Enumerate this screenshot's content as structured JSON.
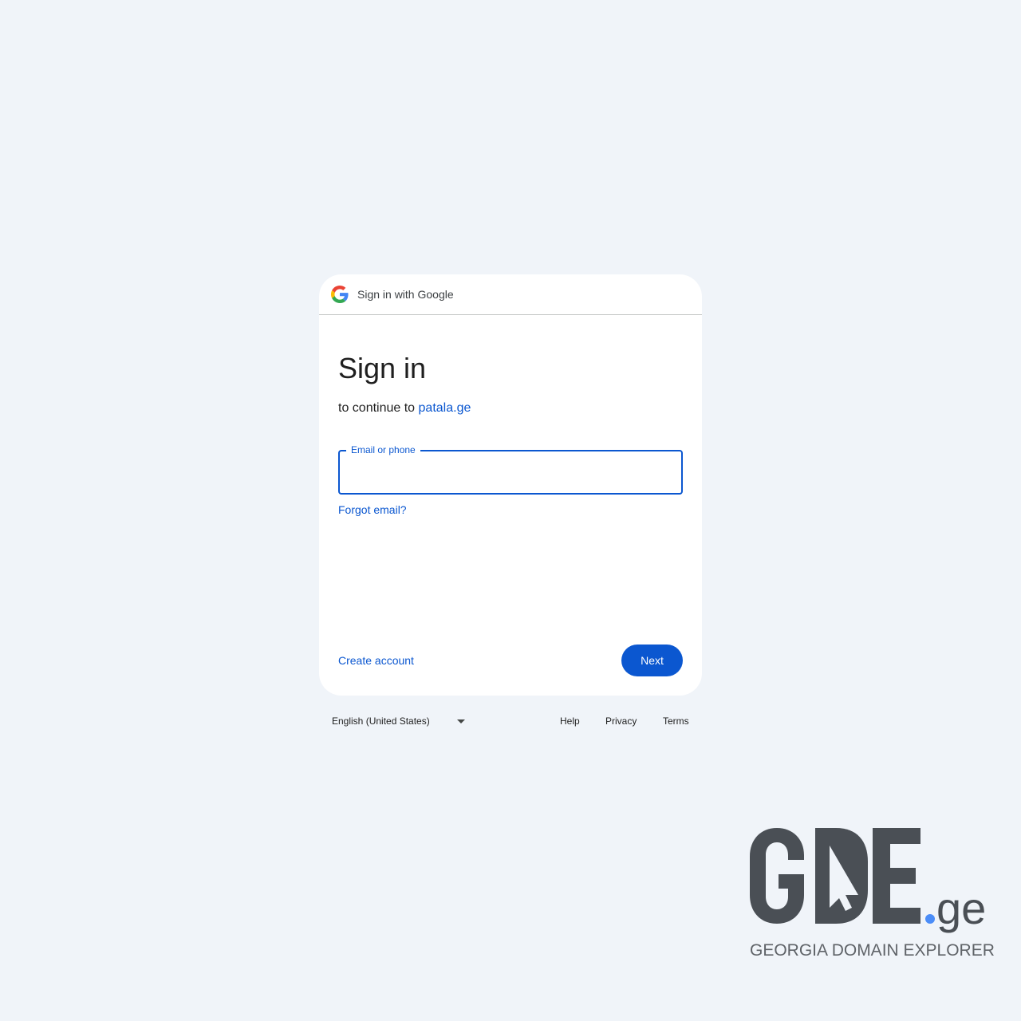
{
  "header": {
    "text": "Sign in with Google",
    "logo_icon": "google-g-icon"
  },
  "main": {
    "title": "Sign in",
    "subtitle_prefix": "to continue to",
    "subtitle_link": "patala.ge",
    "email_field": {
      "label": "Email or phone",
      "value": ""
    },
    "forgot_email": "Forgot email?",
    "create_account": "Create account",
    "next_button": "Next"
  },
  "footer": {
    "language": "English (United States)",
    "links": [
      "Help",
      "Privacy",
      "Terms"
    ]
  },
  "watermark": {
    "brand": "GDE.ge",
    "tagline": "GEORGIA DOMAIN EXPLORER"
  },
  "colors": {
    "accent": "#0b57d0",
    "background": "#f0f4f9",
    "card": "#ffffff"
  }
}
